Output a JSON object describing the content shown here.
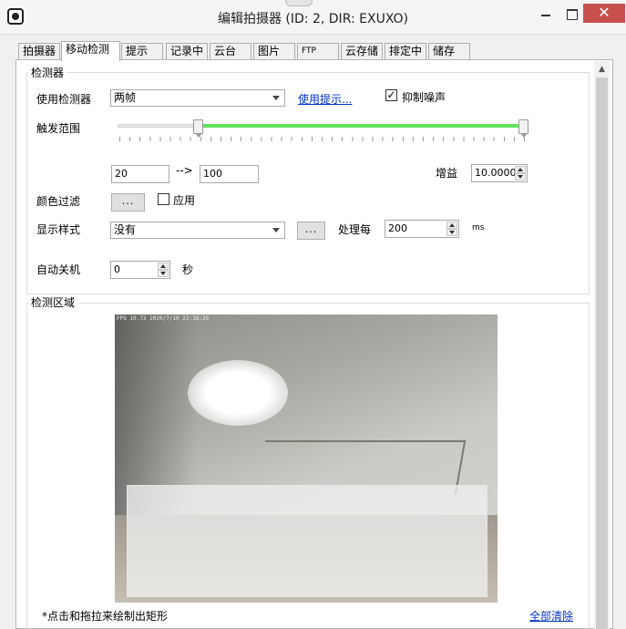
{
  "window": {
    "title": "编辑拍摄器 (ID: 2, DIR: EXUXO)",
    "close_label": "✕"
  },
  "tabs": [
    {
      "label": "拍摄器"
    },
    {
      "label": "移动检测"
    },
    {
      "label": "提示"
    },
    {
      "label": "记录中"
    },
    {
      "label": "云台"
    },
    {
      "label": "图片"
    },
    {
      "label": "FTP"
    },
    {
      "label": "云存储"
    },
    {
      "label": "排定中"
    },
    {
      "label": "储存"
    }
  ],
  "detector": {
    "group_title": "检测器",
    "use_detector_label": "使用检测器",
    "use_detector_value": "两帧",
    "hint_link": "使用提示...",
    "noise_checkbox_checked": true,
    "noise_checkbox_mark": "✓",
    "noise_label": "抑制噪声",
    "trigger_range_label": "触发范围",
    "range_from": "20",
    "range_arrow": "-->",
    "range_to": "100",
    "range_fraction": [
      0.2,
      1.0
    ],
    "gain_label": "增益",
    "gain_value": "10.0000",
    "color_filter_label": "颜色过滤",
    "color_filter_button": "...",
    "apply_label": "应用",
    "apply_checked": false,
    "display_style_label": "显示样式",
    "display_style_value": "没有",
    "display_style_button": "...",
    "process_every_label": "处理每",
    "process_every_value": "200",
    "process_unit": "ms",
    "auto_off_label": "自动关机",
    "auto_off_value": "0",
    "auto_off_unit": "秒"
  },
  "detection_area": {
    "group_title": "检测区域",
    "camera_osd": "FPS 10.73 2020/7/10 22:16:26",
    "instructions": "*点击和拖拉来绘制出矩形",
    "clear_all_link": "全部清除"
  },
  "icons": {
    "app": "camera-eye-icon",
    "minimize": "minimize-icon",
    "maximize": "maximize-icon",
    "close": "close-icon"
  }
}
